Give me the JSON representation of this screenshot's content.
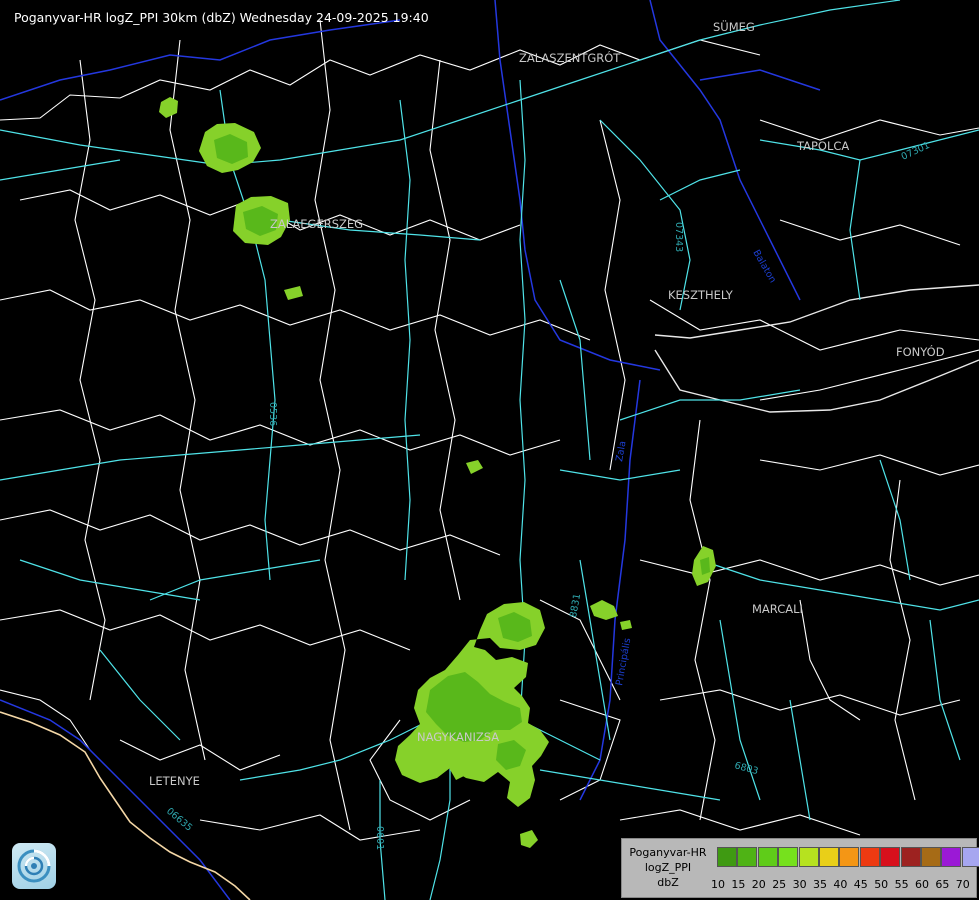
{
  "header": {
    "title": "Poganyvar-HR logZ_PPI 30km (dbZ) Wednesday 24-09-2025 19:40"
  },
  "map": {
    "towns": [
      "SÜMEG",
      "ZALASZENTGRÓT",
      "TAPOLCA",
      "ZALAEGERSZEG",
      "KESZTHELY",
      "FONYÓD",
      "MARCALI",
      "NAGYKANIZSA",
      "LETENYE"
    ],
    "road_labels": [
      "07343",
      "0536",
      "8831",
      "6803",
      "06635",
      "0601",
      "07301"
    ],
    "river_labels": [
      "Zala",
      "Balaton",
      "Principális"
    ],
    "colors": {
      "background": "#000000",
      "roads": "#4fe3e8",
      "rivers": "#2438e0",
      "borders": "#ffffff",
      "country_border": "#f4d7a6"
    }
  },
  "echoes": {
    "color_light": "#86d12a",
    "color_dark": "#59b81b"
  },
  "legend": {
    "line1": "Poganyvar-HR",
    "line2": "logZ_PPI",
    "line3": "dbZ",
    "ticks": [
      "10",
      "15",
      "20",
      "25",
      "30",
      "35",
      "40",
      "45",
      "50",
      "55",
      "60",
      "65",
      "70"
    ],
    "colors": [
      "#3f9a12",
      "#4fb315",
      "#5fcc19",
      "#76e11d",
      "#b6e21f",
      "#e9cf18",
      "#f49615",
      "#ee3a12",
      "#d8101c",
      "#9d2220",
      "#a66b16",
      "#9b19d6",
      "#a6a6f0"
    ]
  },
  "logo": {
    "icon": "radar-agency-logo-icon"
  }
}
